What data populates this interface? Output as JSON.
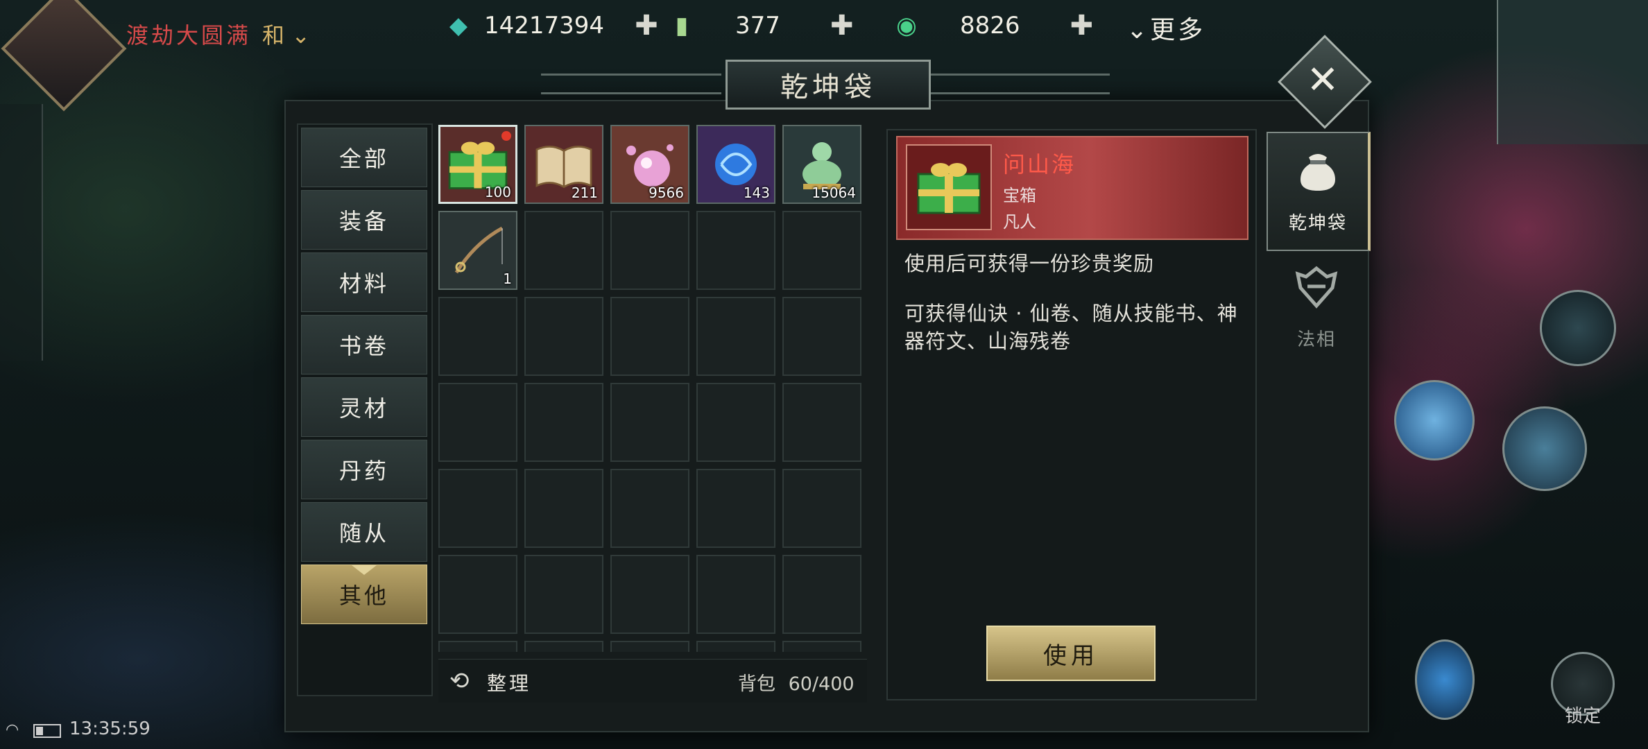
{
  "player": {
    "name": "渡劫大圆满",
    "mode": "和"
  },
  "currencies": [
    {
      "icon": "jade-crystal-icon",
      "value": "14217394"
    },
    {
      "icon": "scroll-token-icon",
      "value": "377"
    },
    {
      "icon": "jade-bracelet-icon",
      "value": "8826"
    }
  ],
  "top_more": "更多",
  "window": {
    "title": "乾坤袋"
  },
  "categories": [
    "全部",
    "装备",
    "材料",
    "书卷",
    "灵材",
    "丹药",
    "随从",
    "其他"
  ],
  "active_category": "其他",
  "items": [
    {
      "name": "gift-box-icon",
      "qty": "100",
      "selected": true,
      "new": true
    },
    {
      "name": "book-icon",
      "qty": "211"
    },
    {
      "name": "pearl-icon",
      "qty": "9566"
    },
    {
      "name": "blue-spirit-orb-icon",
      "qty": "143"
    },
    {
      "name": "jade-buddha-icon",
      "qty": "15064"
    },
    {
      "name": "fishing-rod-icon",
      "qty": "1"
    }
  ],
  "bottom_bar": {
    "sort_label": "整理",
    "capacity_label": "背包",
    "capacity_value": "60/400"
  },
  "detail": {
    "name": "问山海",
    "type": "宝箱",
    "rank": "凡人",
    "desc1": "使用后可获得一份珍贵奖励",
    "desc2": "可获得仙诀 · 仙卷、随从技能书、神器符文、山海残卷",
    "use_label": "使用"
  },
  "right_tabs": [
    {
      "label": "乾坤袋",
      "icon": "pouch-icon",
      "active": true
    },
    {
      "label": "法相",
      "icon": "dharma-mask-icon",
      "active": false
    }
  ],
  "status": {
    "time": "13:35:59"
  },
  "hud": {
    "lock_label": "锁定"
  }
}
